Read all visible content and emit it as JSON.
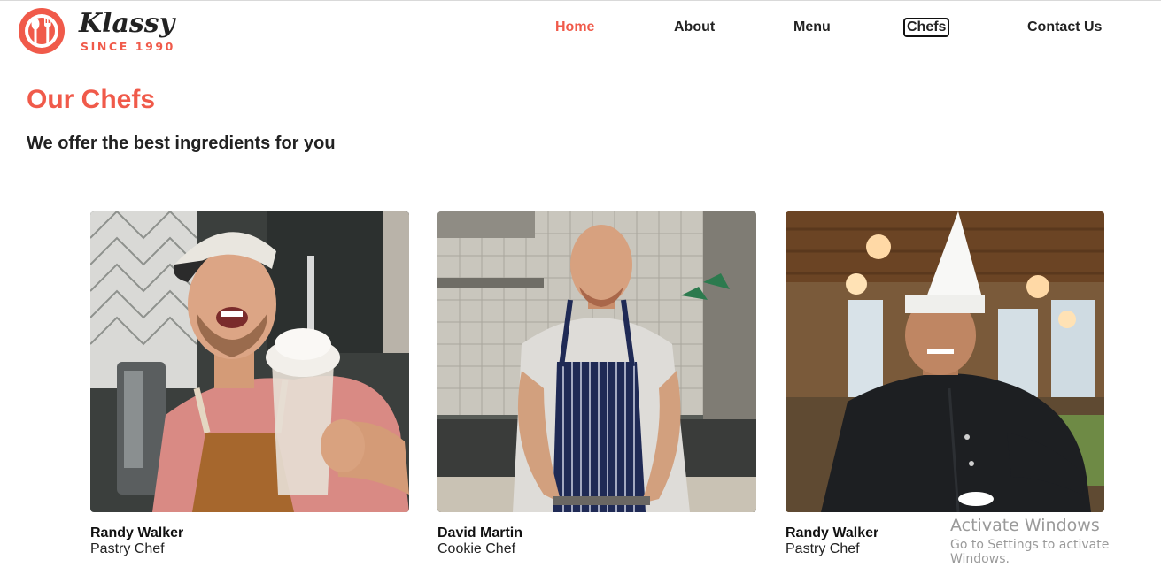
{
  "brand": {
    "name": "Klassy",
    "tagline": "SINCE 1990",
    "accent_color": "#f05a4a",
    "icon": "fork-spoon-plate-icon"
  },
  "nav": {
    "items": [
      {
        "label": "Home",
        "state": "active"
      },
      {
        "label": "About",
        "state": "normal"
      },
      {
        "label": "Menu",
        "state": "normal"
      },
      {
        "label": "Chefs",
        "state": "focused"
      },
      {
        "label": "Contact Us",
        "state": "normal"
      }
    ]
  },
  "section": {
    "title": "Our Chefs",
    "subtitle": "We offer the best ingredients for you"
  },
  "chefs": [
    {
      "name": "Randy Walker",
      "role": "Pastry Chef",
      "photo": "chef-photo-milkshake"
    },
    {
      "name": "David Martin",
      "role": "Cookie Chef",
      "photo": "chef-photo-kitchen"
    },
    {
      "name": "Randy Walker",
      "role": "Pastry Chef",
      "photo": "chef-photo-toque"
    }
  ],
  "watermark": {
    "line1": "Activate Windows",
    "line2": "Go to Settings to activate Windows."
  }
}
